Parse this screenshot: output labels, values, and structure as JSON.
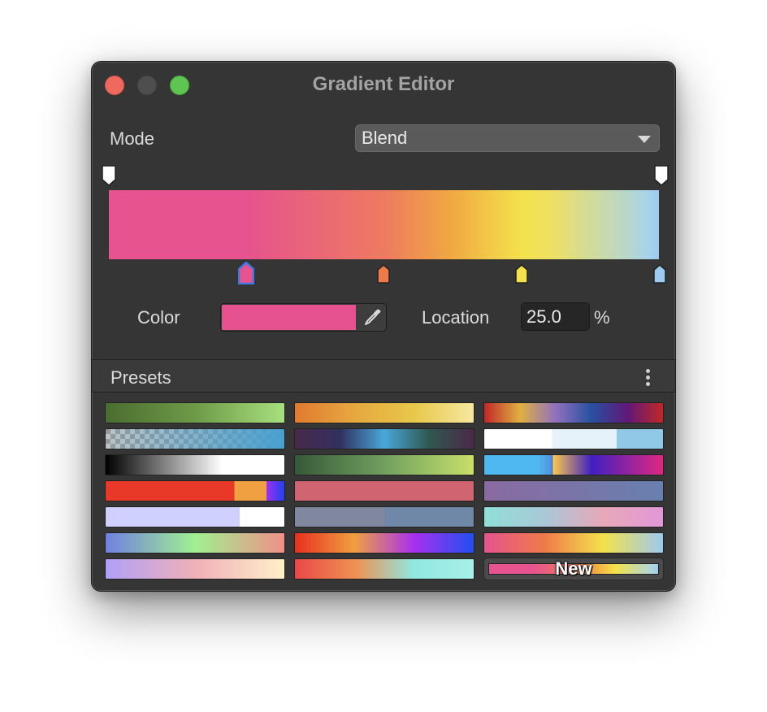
{
  "window": {
    "title": "Gradient Editor"
  },
  "mode": {
    "label": "Mode",
    "value": "Blend"
  },
  "gradient": {
    "opacity_stops": [
      {
        "location": 0,
        "color": "#ffffff"
      },
      {
        "location": 100,
        "color": "#ffffff"
      }
    ],
    "color_stops": [
      {
        "location": 25,
        "color": "#e6538e",
        "selected": true
      },
      {
        "location": 50,
        "color": "#ee7a4a"
      },
      {
        "location": 75,
        "color": "#f3e24c"
      },
      {
        "location": 100,
        "color": "#9ccaf0"
      }
    ]
  },
  "color": {
    "label": "Color",
    "value": "#e6528f"
  },
  "location": {
    "label": "Location",
    "value": "25.0",
    "unit": "%"
  },
  "presets": {
    "label": "Presets",
    "new_label": "New",
    "items": [
      {
        "gradient": "linear-gradient(to right,#4a6d30,#6e9a48,#a8e07e)"
      },
      {
        "gradient": "linear-gradient(to right,#e07a30,#e6a840,#e8c84a,#f6e8a0)"
      },
      {
        "gradient": "linear-gradient(to right,#c02828,#e0b040,#9070c0,#2850a0,#601878,#c02828)"
      },
      {
        "gradient": "linear-gradient(to right,rgba(90,160,200,0.1),#48a0d0)"
      },
      {
        "gradient": "linear-gradient(to right,#4a2848,#303060,#48a8d8,#305850,#4a2848)"
      },
      {
        "gradient": "linear-gradient(to right,#ffffff 0%,#ffffff 38%,#e6f2fa 38%,#e6f2fa 74%,#90c8e8 74%,#90c8e8 100%)"
      },
      {
        "gradient": "linear-gradient(to right,#000000,#808080,#ffffff 65%,#ffffff)"
      },
      {
        "gradient": "linear-gradient(to right,#385838,#70a060,#c8e068)"
      },
      {
        "gradient": "linear-gradient(to right,#50b8f0 0%,#50b8f0 30%,#5090e0 38%,#2040c0 38%,#f8c850 38.5%,#4020c0 60%,#e02880 100%)"
      },
      {
        "gradient": "linear-gradient(to right,#e83828 0%,#e83828 72%,#f0a040 72%,#f0a040 90%,#a030f0 90%,#2040f0 100%)"
      },
      {
        "gradient": "linear-gradient(to right,#d06470,#d06470)"
      },
      {
        "gradient": "linear-gradient(to right,#8a6aa0,#6880b0)"
      },
      {
        "gradient": "linear-gradient(to right,#d0d0ff 0%,#d0d0ff 75%,#ffffff 75%,#ffffff 100%)"
      },
      {
        "gradient": "linear-gradient(to right,#8088a0 0%,#8088a0 50%,#7088a8 50%,#7088a8 100%)"
      },
      {
        "gradient": "linear-gradient(to right,#90e0d8,#a8c8d8,#e8a8b8,#e098d8)"
      },
      {
        "gradient": "linear-gradient(to right,#7080e0,#a0f090,#f09088)"
      },
      {
        "gradient": "linear-gradient(to right,#e83020,#f0a040,#a830f0,#2050f0)"
      },
      {
        "gradient": "linear-gradient(to right,#e6538e,#ee7a4a,#f3e24c,#9ccaf0)"
      },
      {
        "gradient": "linear-gradient(to right,#b0a0f8,#f0b0b8,#fff0c8)"
      },
      {
        "gradient": "linear-gradient(to right,#e84848,#f09050,#90e8e0,#a8f0e8)"
      }
    ]
  }
}
